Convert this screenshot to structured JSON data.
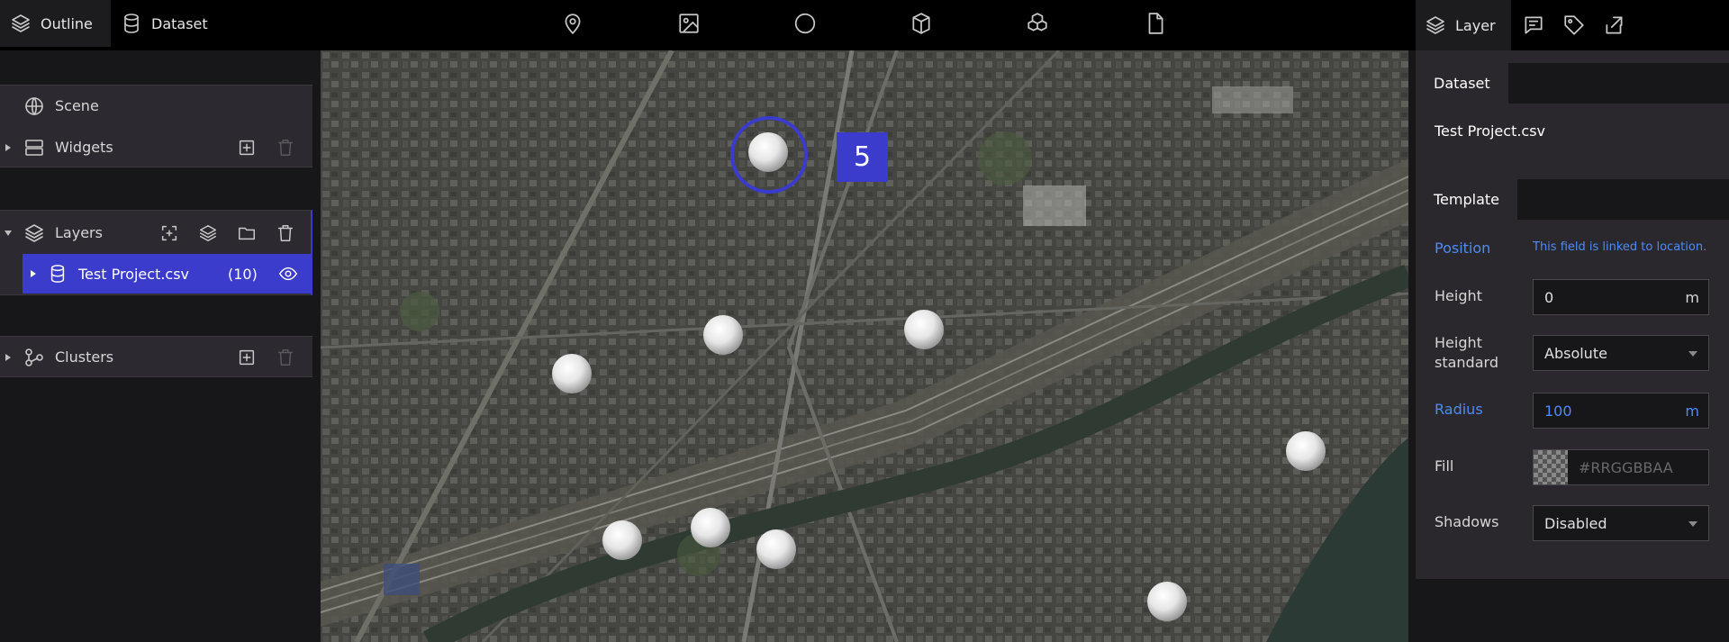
{
  "left_tabs": {
    "outline": "Outline",
    "dataset": "Dataset"
  },
  "toolbar_icons": [
    "marker-icon",
    "image-icon",
    "circle-icon",
    "box-icon",
    "model-icon",
    "file-icon"
  ],
  "right_tabs": {
    "layer": "Layer",
    "icons": [
      "infobox-icon",
      "tag-icon",
      "export-icon"
    ]
  },
  "outline": {
    "scene": "Scene",
    "widgets": "Widgets",
    "layers": "Layers",
    "layer_item": {
      "name": "Test Project.csv",
      "count": "(10)"
    },
    "clusters": "Clusters"
  },
  "map": {
    "cluster_count": "5"
  },
  "inspector": {
    "dataset_tab": "Dataset",
    "dataset_name": "Test Project.csv",
    "template_tab": "Template",
    "position_label": "Position",
    "position_note": "This field is linked to location.",
    "height_label": "Height",
    "height_value": "0",
    "height_unit": "m",
    "height_standard_label_1": "Height",
    "height_standard_label_2": "standard",
    "height_standard_value": "Absolute",
    "radius_label": "Radius",
    "radius_value": "100",
    "radius_unit": "m",
    "fill_label": "Fill",
    "fill_placeholder": "#RRGGBBAA",
    "shadows_label": "Shadows",
    "shadows_value": "Disabled"
  },
  "colors": {
    "accent": "#3b3bcc",
    "link": "#4d8cf5",
    "panel": "#2a282d",
    "background": "#171618"
  }
}
